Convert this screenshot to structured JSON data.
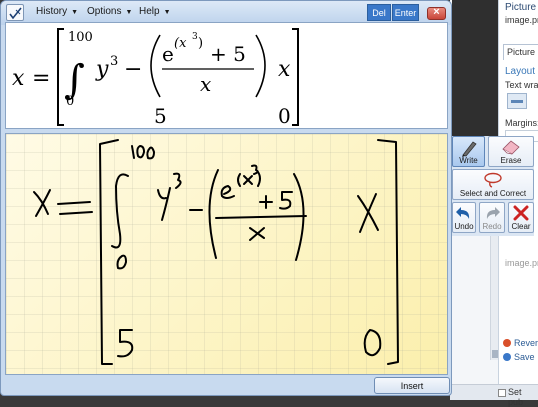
{
  "window": {
    "menus": [
      {
        "label": "History"
      },
      {
        "label": "Options"
      },
      {
        "label": "Help"
      }
    ],
    "buttons": {
      "del": "Del",
      "enter": "Enter",
      "insert": "Insert"
    }
  },
  "preview": {
    "expression": {
      "lhs": "x",
      "equals": "=",
      "upper_limit": "100",
      "lower_limit": "0",
      "integral": "∫",
      "term1_base": "y",
      "term1_exp": "3",
      "minus": "−",
      "exp_base": "e",
      "exp_inner": "(x",
      "exp_inner_pow": "3",
      "exp_inner_close": ")",
      "plus_five": "+ 5",
      "denominator": "x",
      "matrix_r1c2": "x",
      "matrix_r2c1": "5",
      "matrix_r2c2": "0"
    }
  },
  "tools": {
    "write": "Write",
    "erase": "Erase",
    "select_correct": "Select and Correct",
    "undo": "Undo",
    "redo": "Redo",
    "clear": "Clear"
  },
  "background_app": {
    "panel_title": "Picture",
    "image_name_1": "image.pn",
    "tab_label": "Picture",
    "layout_heading": "Layout",
    "text_wrap": "Text wrap",
    "margins": "Margins:",
    "image_name_2": "image.pn",
    "revert_label": "Rever",
    "save_label": "Save",
    "status_text": "Set pub"
  },
  "colors": {
    "accent_blue": "#3a78c9",
    "writing_bg": "#fdf7cf",
    "ink": "#000000",
    "clear_red": "#cc2222",
    "undo_blue": "#1f5fa8"
  }
}
